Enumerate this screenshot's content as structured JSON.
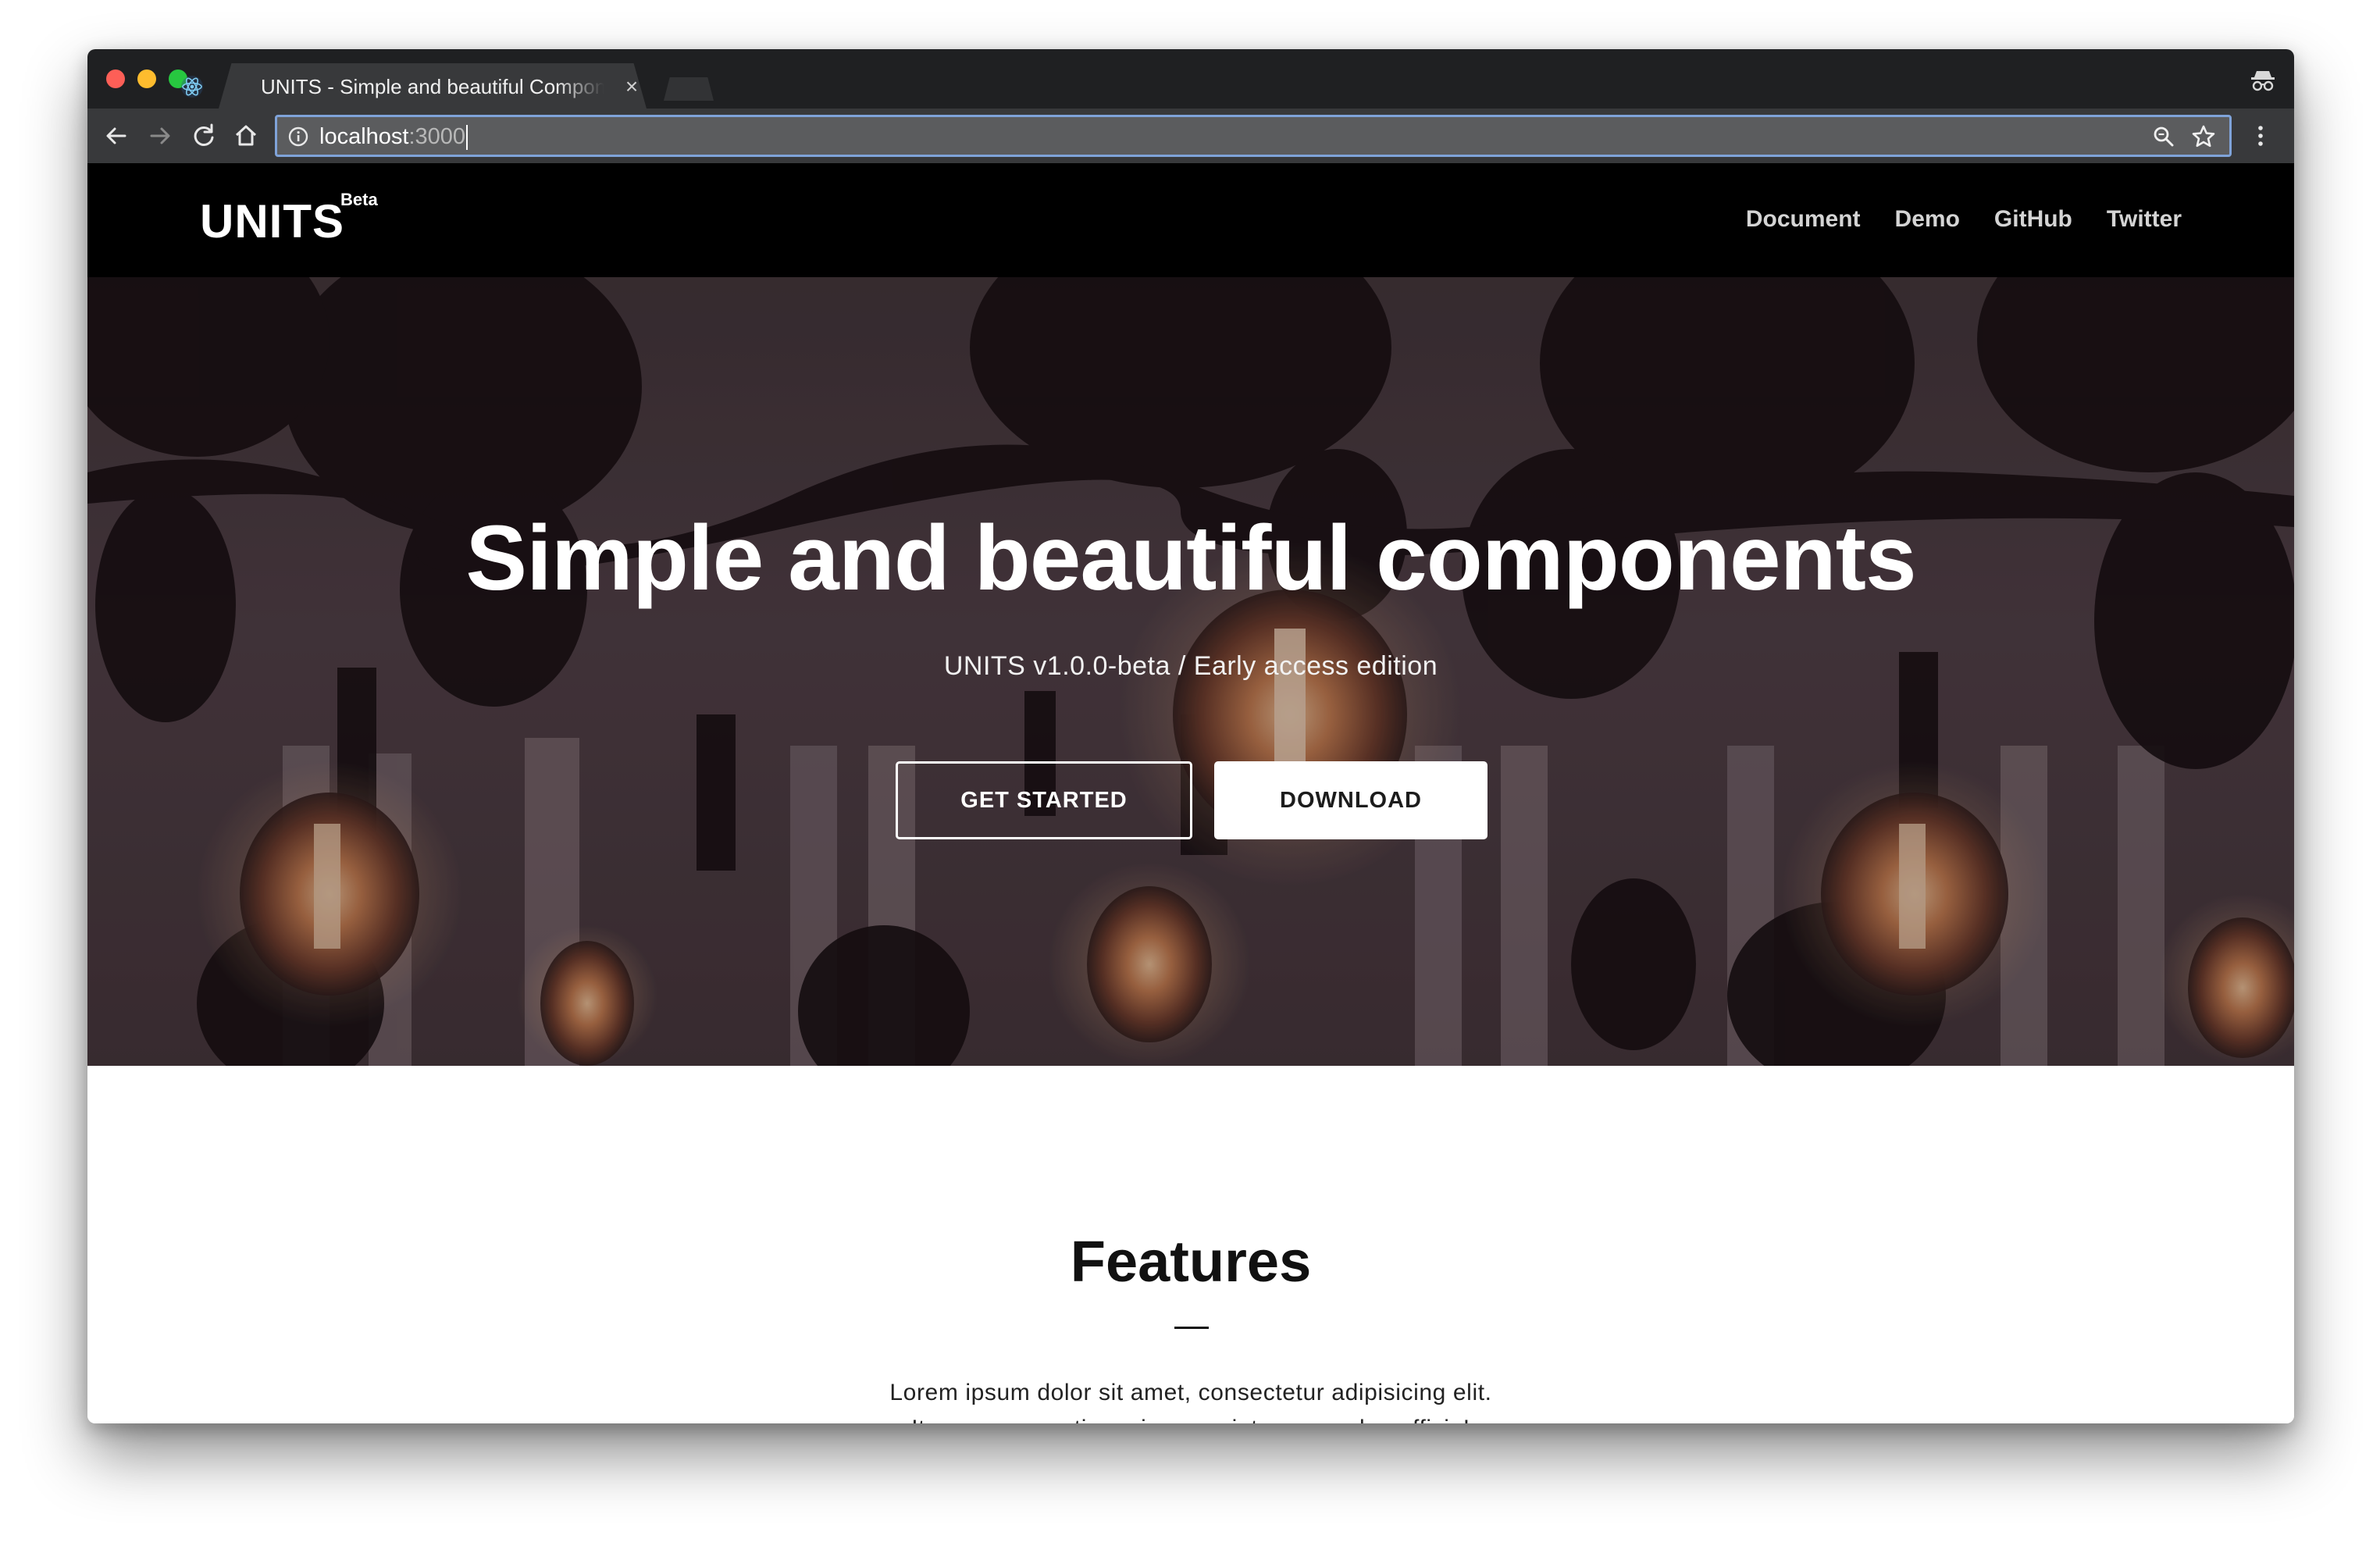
{
  "browser": {
    "tab_title": "UNITS - Simple and beautiful Components",
    "tab_close": "×",
    "url_host": "localhost",
    "url_port": ":3000",
    "icons": {
      "back": "arrow-left-icon",
      "forward": "arrow-right-icon",
      "reload": "reload-icon",
      "home": "home-icon",
      "info": "info-icon",
      "zoom": "magnifier-icon",
      "bookmark": "star-icon",
      "menu": "vertical-dots-icon",
      "incognito": "incognito-icon",
      "favicon": "react-atom-icon"
    },
    "colors": {
      "close": "#fd5f57",
      "minimize": "#febc2e",
      "maximize": "#27c840",
      "omnibox_focus": "#7fa3d9"
    }
  },
  "site": {
    "brand": "UNITS",
    "badge": "Beta",
    "nav": [
      "Document",
      "Demo",
      "GitHub",
      "Twitter"
    ]
  },
  "hero": {
    "title": "Simple and beautiful components",
    "subtitle": "UNITS v1.0.0-beta / Early access edition",
    "primary_button": "GET STARTED",
    "secondary_button": "DOWNLOAD"
  },
  "features": {
    "title": "Features",
    "line1": "Lorem ipsum dolor sit amet, consectetur adipisicing elit.",
    "line2": "Itaque praesentium eius eveniet recusandae officia!"
  }
}
